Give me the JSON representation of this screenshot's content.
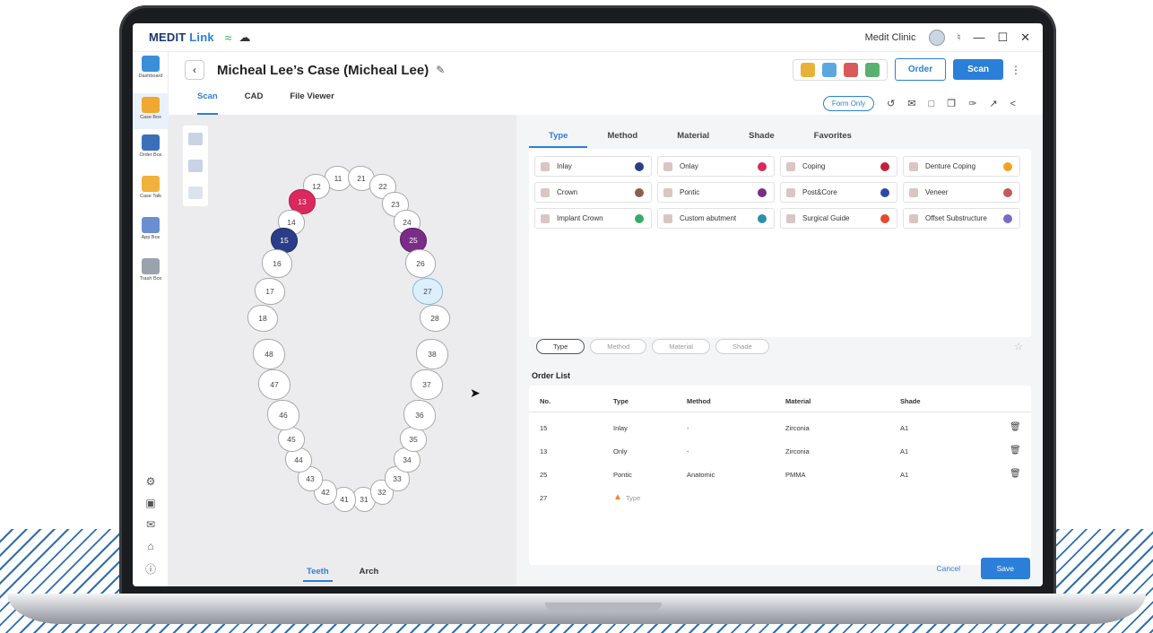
{
  "app": {
    "brand_a": "MEDIT",
    "brand_b": "Link",
    "clinic": "Medit Clinic"
  },
  "nav": [
    "Dashboard",
    "Case Box",
    "Order Box",
    "Case Talk",
    "App Box",
    "Trash Box"
  ],
  "header": {
    "title": "Micheal Lee’s Case (Micheal Lee)",
    "order": "Order",
    "scan": "Scan"
  },
  "subtabs": [
    "Scan",
    "CAD",
    "File Viewer"
  ],
  "form_only": "Form Only",
  "teeth_upper": [
    "11",
    "12",
    "13",
    "14",
    "15",
    "16",
    "17",
    "18",
    "21",
    "22",
    "23",
    "24",
    "25",
    "26",
    "27",
    "28"
  ],
  "teeth_lower": [
    "31",
    "32",
    "33",
    "34",
    "35",
    "36",
    "37",
    "38",
    "41",
    "42",
    "43",
    "44",
    "45",
    "46",
    "47",
    "48"
  ],
  "bottomtabs": [
    "Teeth",
    "Arch"
  ],
  "rtabs": [
    "Type",
    "Method",
    "Material",
    "Shade",
    "Favorites"
  ],
  "types": [
    {
      "label": "Inlay",
      "color": "#2c3d88"
    },
    {
      "label": "Onlay",
      "color": "#d9295e"
    },
    {
      "label": "Coping",
      "color": "#c4203b"
    },
    {
      "label": "Denture Coping",
      "color": "#f4a21f"
    },
    {
      "label": "Crown",
      "color": "#8b5e4e"
    },
    {
      "label": "Pontic",
      "color": "#7a2d86"
    },
    {
      "label": "Post&Core",
      "color": "#2c4aa8"
    },
    {
      "label": "Veneer",
      "color": "#c25b5b"
    },
    {
      "label": "Implant Crown",
      "color": "#3aaa6a"
    },
    {
      "label": "Custom abutment",
      "color": "#2a8fb0"
    },
    {
      "label": "Surgical Guide",
      "color": "#e8492a"
    },
    {
      "label": "Offset Substructure",
      "color": "#7a6bc4"
    }
  ],
  "chips": [
    "Type",
    "Method",
    "Material",
    "Shade"
  ],
  "order_list": {
    "label": "Order List",
    "headers": [
      "No.",
      "Type",
      "Method",
      "Material",
      "Shade"
    ],
    "rows": [
      [
        "15",
        "Inlay",
        "-",
        "Zirconia",
        "A1"
      ],
      [
        "13",
        "Only",
        "-",
        "Zirconia",
        "A1"
      ],
      [
        "25",
        "Pontic",
        "Anatomic",
        "PMMA",
        "A1"
      ],
      [
        "27",
        "Type",
        "",
        "",
        ""
      ]
    ]
  },
  "actions": {
    "cancel": "Cancel",
    "save": "Save"
  }
}
